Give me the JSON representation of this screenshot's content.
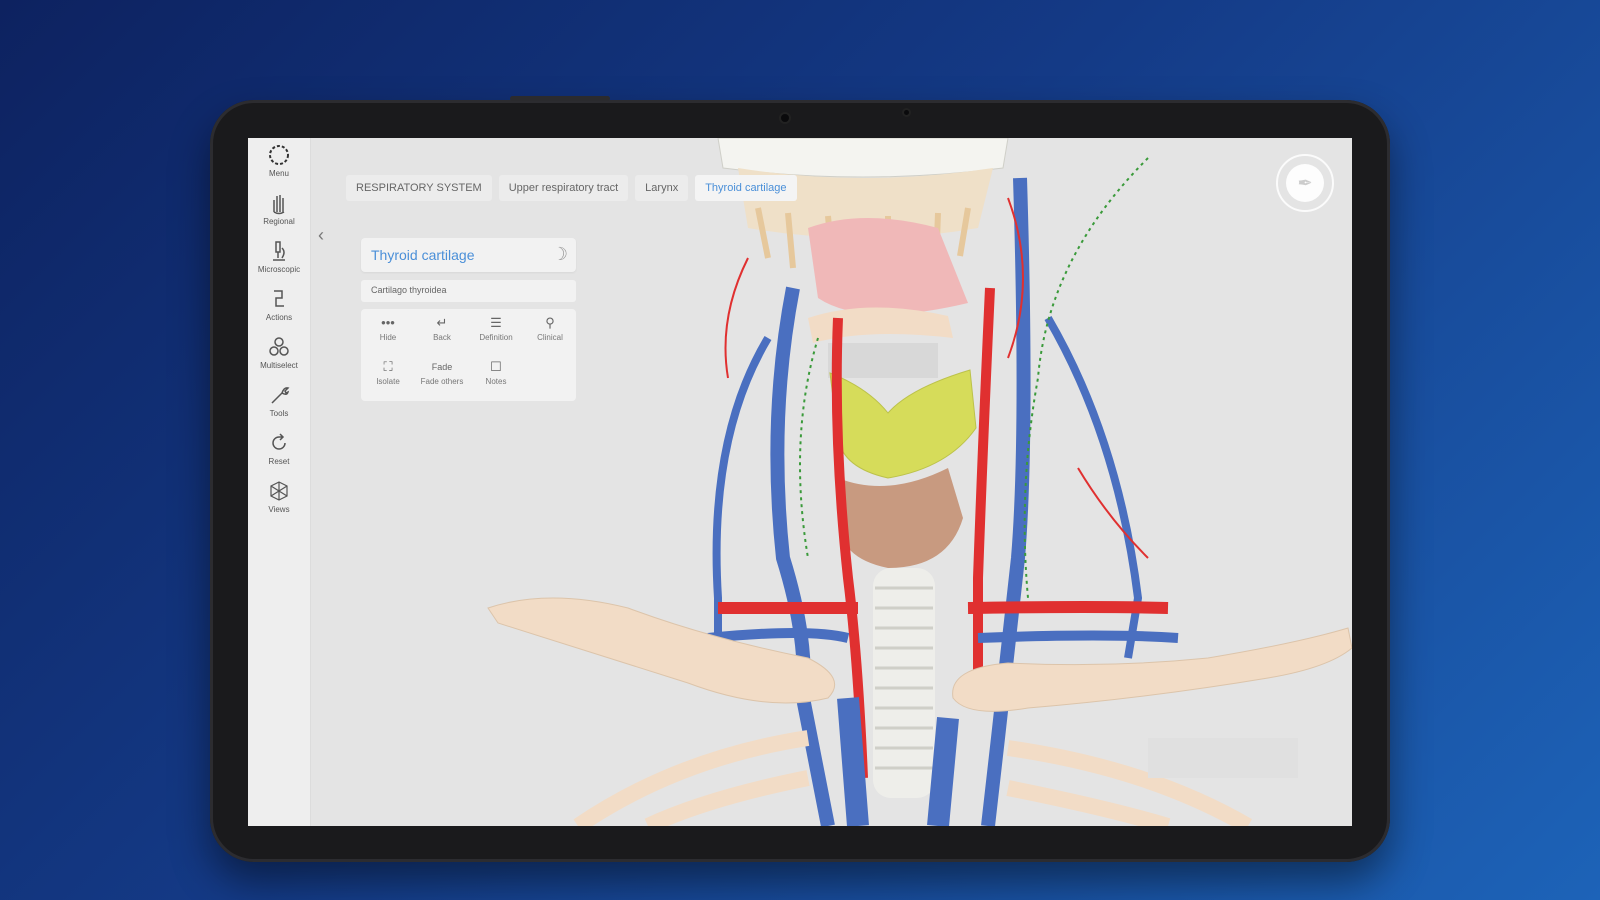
{
  "app": {
    "sidebar": {
      "items": [
        {
          "label": "Menu",
          "icon": "menu-icon"
        },
        {
          "label": "Regional",
          "icon": "hand-icon"
        },
        {
          "label": "Microscopic",
          "icon": "microscope-icon"
        },
        {
          "label": "Actions",
          "icon": "actions-icon"
        },
        {
          "label": "Multiselect",
          "icon": "multiselect-icon"
        },
        {
          "label": "Tools",
          "icon": "tools-icon"
        },
        {
          "label": "Reset",
          "icon": "reset-icon"
        },
        {
          "label": "Views",
          "icon": "views-icon"
        }
      ]
    },
    "breadcrumbs": [
      {
        "label": "RESPIRATORY SYSTEM"
      },
      {
        "label": "Upper respiratory tract"
      },
      {
        "label": "Larynx"
      },
      {
        "label": "Thyroid cartilage"
      }
    ],
    "structure_panel": {
      "title": "Thyroid cartilage",
      "latin_name": "Cartilago thyroidea",
      "actions": [
        {
          "label": "Hide",
          "icon": "more-dots-icon"
        },
        {
          "label": "Back",
          "icon": "back-arrow-icon"
        },
        {
          "label": "Definition",
          "icon": "definition-icon"
        },
        {
          "label": "Clinical",
          "icon": "clinical-icon"
        },
        {
          "label": "Isolate",
          "icon": "isolate-icon"
        },
        {
          "label": "Fade",
          "sublabel": "Fade others",
          "icon": "fade-icon"
        },
        {
          "label": "Notes",
          "icon": "notes-icon"
        }
      ]
    },
    "colors": {
      "accent": "#4a8fd8",
      "thyroid_cartilage": "#d6dc5a",
      "artery": "#e03030",
      "vein": "#4a6fc0",
      "lymph": "#3a9a3a",
      "bone": "#f2dcc6"
    }
  }
}
